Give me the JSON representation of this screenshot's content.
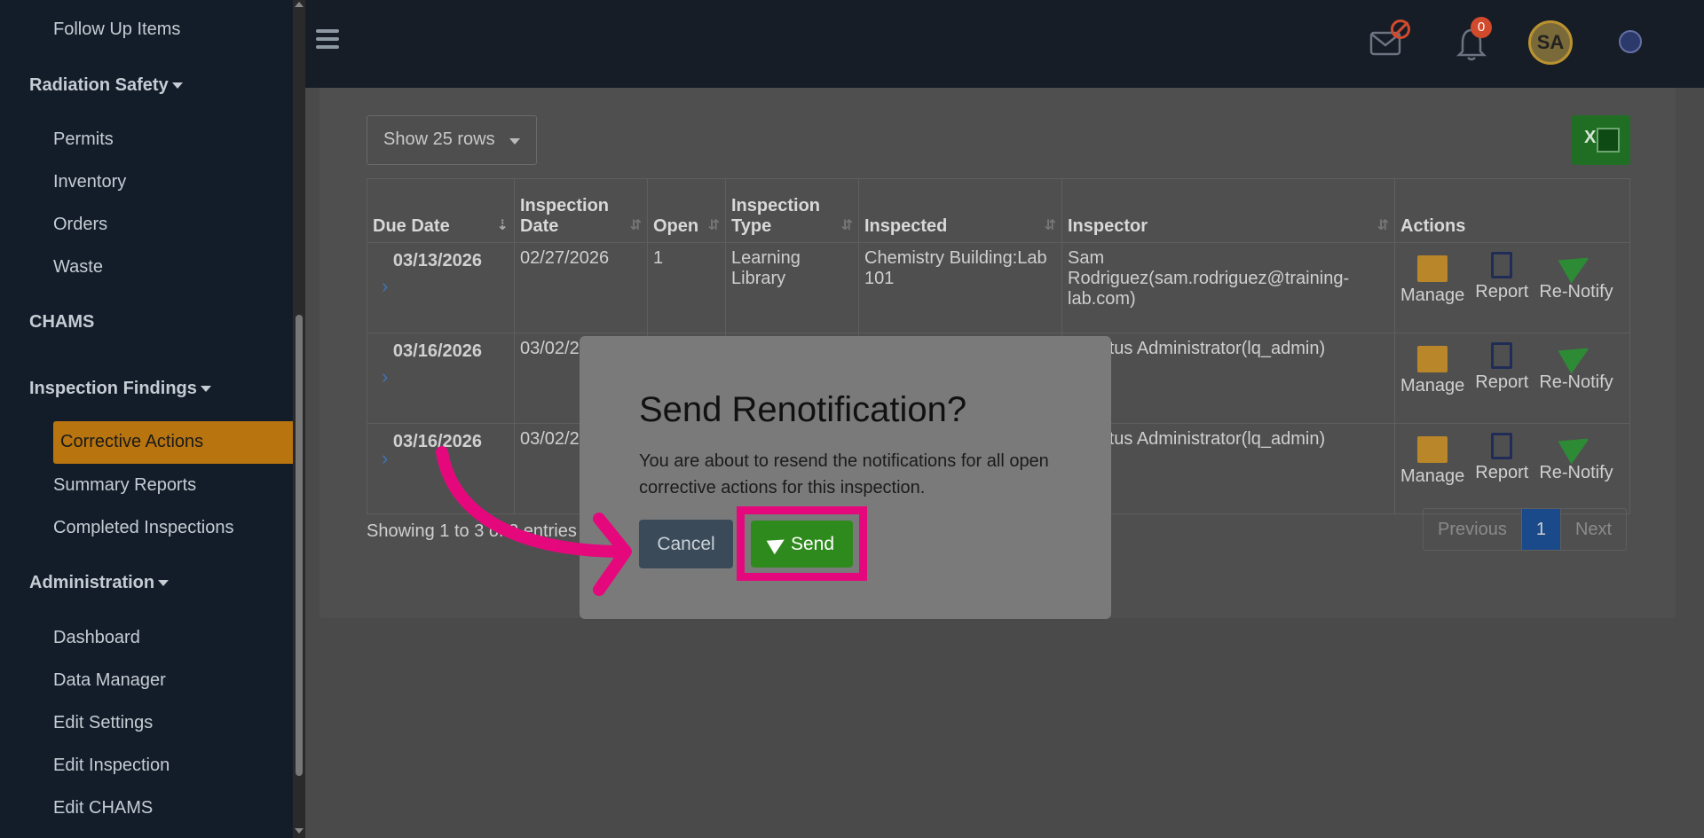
{
  "sidebar": {
    "items": [
      {
        "label": "Follow Up Items",
        "type": "sub"
      },
      {
        "label": "Radiation Safety",
        "type": "section"
      },
      {
        "label": "Permits",
        "type": "sub"
      },
      {
        "label": "Inventory",
        "type": "sub"
      },
      {
        "label": "Orders",
        "type": "sub"
      },
      {
        "label": "Waste",
        "type": "sub"
      },
      {
        "label": "CHAMS",
        "type": "section"
      },
      {
        "label": "Inspection Findings",
        "type": "section"
      },
      {
        "label": "Corrective Actions",
        "type": "active"
      },
      {
        "label": "Summary Reports",
        "type": "sub"
      },
      {
        "label": "Completed Inspections",
        "type": "sub"
      },
      {
        "label": "Administration",
        "type": "section"
      },
      {
        "label": "Dashboard",
        "type": "sub"
      },
      {
        "label": "Data Manager",
        "type": "sub"
      },
      {
        "label": "Edit Settings",
        "type": "sub"
      },
      {
        "label": "Edit Inspection",
        "type": "sub"
      },
      {
        "label": "Edit CHAMS",
        "type": "sub"
      }
    ]
  },
  "topbar": {
    "notification_count": "0",
    "avatar_initials": "SA"
  },
  "toolbar": {
    "show_rows": "Show 25 rows"
  },
  "table": {
    "headers": [
      "Due Date",
      "Inspection Date",
      "Open",
      "Inspection Type",
      "Inspected",
      "Inspector",
      "Actions"
    ],
    "header_lines": {
      "inspection_date": [
        "Inspection",
        "Date"
      ],
      "inspection_type": [
        "Inspection",
        "Type"
      ]
    },
    "rows": [
      {
        "due": "03/13/2026",
        "date": "02/27/2026",
        "open": "1",
        "type": "Learning Library",
        "inspected": "Chemistry Building:Lab 101",
        "inspector": "Sam Rodriguez(sam.rodriguez@training-lab.com)"
      },
      {
        "due": "03/16/2026",
        "date": "03/02/2",
        "open": "",
        "type": "",
        "inspected": "",
        "inspector": "yStratus Administrator(lq_admin)"
      },
      {
        "due": "03/16/2026",
        "date": "03/02/2",
        "open": "",
        "type": "",
        "inspected": "",
        "inspector": "yStratus Administrator(lq_admin)"
      }
    ],
    "action_labels": {
      "manage": "Manage",
      "report": "Report",
      "renotify": "Re-Notify"
    }
  },
  "footer": {
    "showing": "Showing 1 to 3 of 3 entries",
    "prev": "Previous",
    "page": "1",
    "next": "Next"
  },
  "modal": {
    "title": "Send Renotification?",
    "text": "You are about to resend the notifications for all open corrective actions for this inspection.",
    "cancel": "Cancel",
    "send": "Send"
  },
  "colors": {
    "highlight": "#e5087d",
    "send": "#2f8a1e",
    "active_nav": "#b8740f"
  }
}
